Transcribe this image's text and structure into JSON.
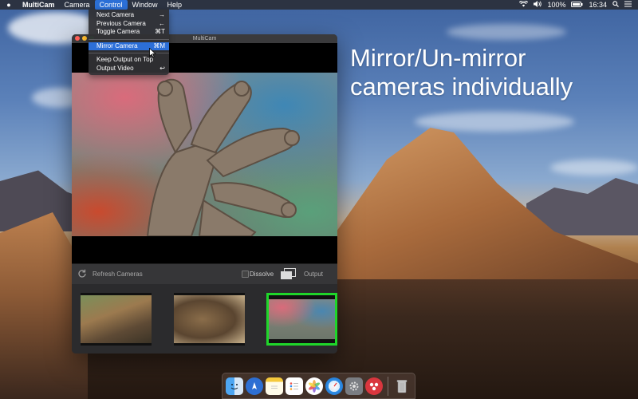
{
  "menubar": {
    "app_name": "MultiCam",
    "menus": [
      "Camera",
      "Control",
      "Window",
      "Help"
    ],
    "active_menu": "Control",
    "status": {
      "battery": "100%",
      "time": "16:34"
    }
  },
  "control_menu": {
    "items": [
      {
        "label": "Next Camera",
        "shortcut": "→"
      },
      {
        "label": "Previous Camera",
        "shortcut": "←"
      },
      {
        "label": "Toggle Camera",
        "shortcut": "⌘T"
      },
      {
        "label": "Mirror Camera",
        "shortcut": "⌘M",
        "highlighted": true
      },
      {
        "label": "Keep Output on Top",
        "shortcut": ""
      },
      {
        "label": "Output Video",
        "shortcut": "↩"
      }
    ]
  },
  "window": {
    "title": "MultiCam",
    "controls": {
      "refresh_label": "Refresh Cameras",
      "dissolve_label": "Dissolve",
      "dissolve_checked": false,
      "output_label": "Output"
    },
    "thumbnails": [
      {
        "name": "lizard-on-log",
        "selected": false
      },
      {
        "name": "lizard-closeup",
        "selected": false
      },
      {
        "name": "gecko-hand",
        "selected": true
      }
    ]
  },
  "headline": {
    "line1": "Mirror/Un-mirror",
    "line2": "cameras individually"
  },
  "dock": {
    "icons": [
      "finder-icon",
      "launchpad-icon",
      "notes-icon",
      "reminders-icon",
      "photos-icon",
      "safari-icon",
      "system-preferences-icon",
      "multicam-icon",
      "trash-icon"
    ]
  },
  "colors": {
    "accent": "#2b6fd6",
    "selected_thumb": "#1fd62a"
  }
}
